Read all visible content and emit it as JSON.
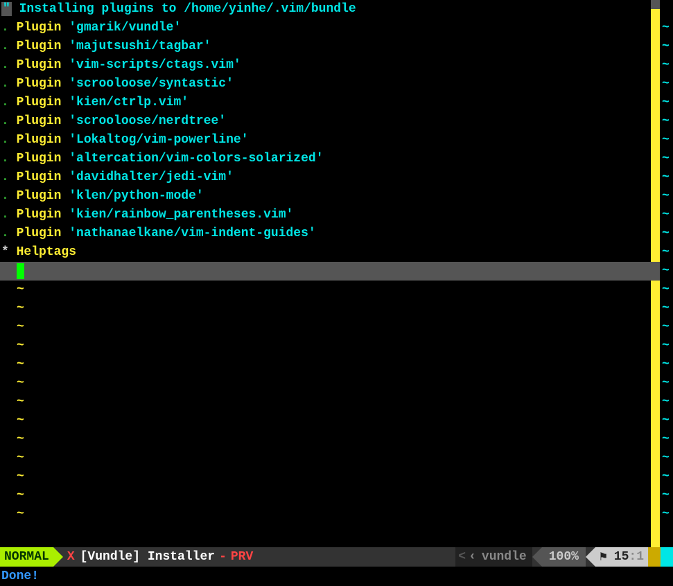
{
  "header": {
    "quote": "\"",
    "text": " Installing plugins to /home/yinhe/.vim/bundle"
  },
  "plugins": [
    "'gmarik/vundle'",
    "'majutsushi/tagbar'",
    "'vim-scripts/ctags.vim'",
    "'scrooloose/syntastic'",
    "'kien/ctrlp.vim'",
    "'scrooloose/nerdtree'",
    "'Lokaltog/vim-powerline'",
    "'altercation/vim-colors-solarized'",
    "'davidhalter/jedi-vim'",
    "'klen/python-mode'",
    "'kien/rainbow_parentheses.vim'",
    "'nathanaelkane/vim-indent-guides'"
  ],
  "plugin_label": "Plugin",
  "plugin_dot": ".",
  "helptags": {
    "star": "*",
    "text": "Helptags"
  },
  "statusline": {
    "mode": "NORMAL",
    "x": "X",
    "filename": "[Vundle] Installer",
    "dash": "-",
    "prv": "PRV",
    "lt": "<",
    "angle": "‹",
    "filetype": "vundle",
    "percent": "100%",
    "flag": "⚑",
    "line": "15",
    "col": ":1"
  },
  "cmdline": "Done!",
  "tilde": "~"
}
